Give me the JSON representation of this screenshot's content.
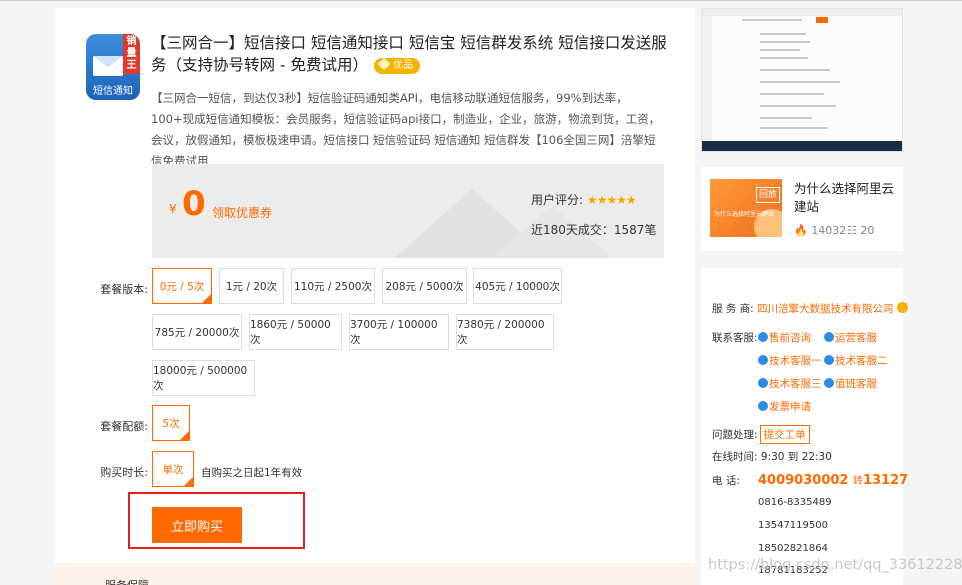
{
  "product": {
    "logo_tag": "销量王",
    "logo_caption": "短信通知",
    "title": "【三网合一】短信接口 短信通知接口 短信宝 短信群发系统 短信接口发送服务（支持协号转网 - 免费试用）",
    "badge": "优品",
    "description": "【三网合一短信，到达仅3秒】短信验证码通知类API，电信移动联通短信服务，99%到达率，100+现成短信通知模板：会员服务，短信验证码api接口，制造业，企业，旅游，物流到货，工资，会议，放假通知，模板极速申请。短信接口 短信验证码 短信通知 短信群发【106全国三网】涪擎短信免费试用"
  },
  "price": {
    "currency": "¥",
    "value": "0",
    "coupon": "领取优惠券",
    "rating_label": "用户评分:",
    "rating_stars": "★★★★★",
    "sales": "近180天成交：1587笔"
  },
  "options": {
    "version_label": "套餐版本:",
    "versions": [
      "0元 / 5次",
      "1元 / 20次",
      "110元 / 2500次",
      "208元 / 5000次",
      "405元 / 10000次",
      "785元 / 20000次",
      "1860元 / 50000次",
      "3700元 / 100000次",
      "7380元 / 200000次",
      "18000元 / 500000次"
    ],
    "quota_label": "套餐配额:",
    "quota": "5次",
    "duration_label": "购买时长:",
    "duration": "单次",
    "duration_note": "自购买之日起1年有效"
  },
  "buy_button": "立即购买",
  "bottom_strip": "服务保障",
  "article": {
    "thumb_tag": "回放",
    "thumb_text": "为什么选择阿里云建站",
    "title": "为什么选择阿里云建站",
    "views": "14032",
    "comments": "20"
  },
  "seller": {
    "merchant_label": "服 务 商:",
    "merchant": "四川涪擎大数据技术有限公司",
    "service_label": "联系客服:",
    "contacts": [
      "售前咨询",
      "运营客服",
      "技术客服一",
      "技术客服二",
      "技术客服三",
      "值班客服",
      "发票申请"
    ],
    "issue_label": "问题处理:",
    "ticket": "提交工单",
    "hours_label": "在线时间:",
    "hours": "9:30 到 22:30",
    "phone_label": "电    话:",
    "phone_main": "4009030002",
    "phone_ext_label": "转",
    "phone_ext": "13127",
    "numbers": [
      "0816-8335489",
      "13547119500",
      "18502821864",
      "18781183252"
    ]
  },
  "watermark": "https://blog.csdn.net/qq_33612228",
  "colors": {
    "accent": "#ff6a00",
    "highlight_frame": "#e22020",
    "badge": "#f5b300"
  }
}
